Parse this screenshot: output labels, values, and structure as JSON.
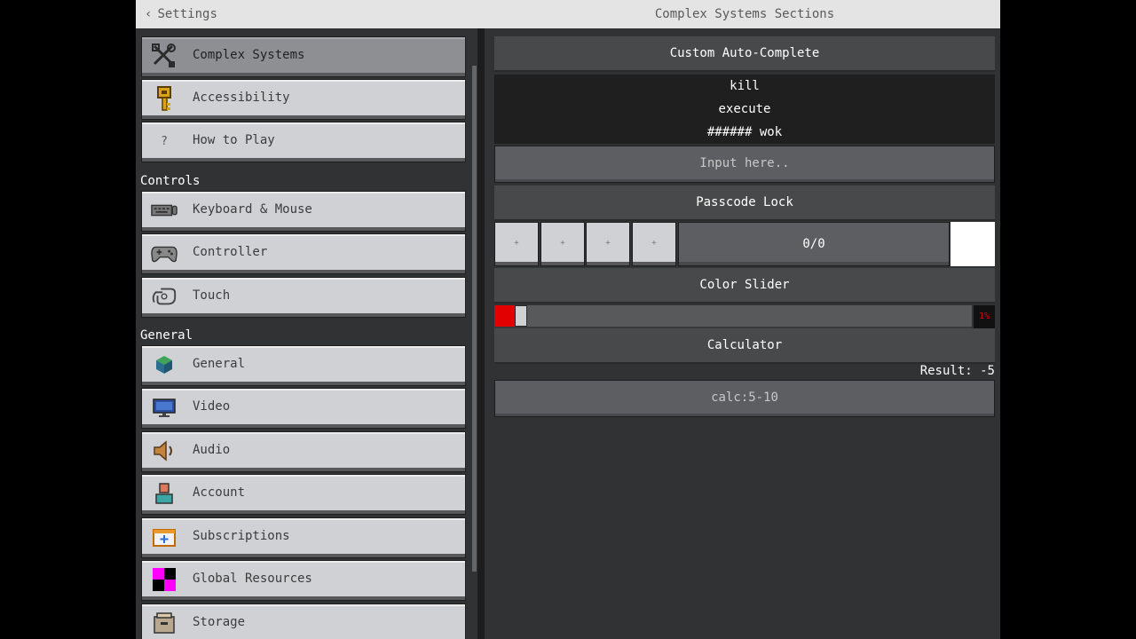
{
  "header": {
    "back_label": "Settings",
    "title": "Complex Systems Sections"
  },
  "sidebar": {
    "top_items": [
      {
        "label": "Complex Systems",
        "icon": "tools-icon",
        "active": true
      },
      {
        "label": "Accessibility",
        "icon": "key-icon"
      },
      {
        "label": "How to Play",
        "icon": "question-icon"
      }
    ],
    "controls_label": "Controls",
    "controls_items": [
      {
        "label": "Keyboard & Mouse",
        "icon": "keyboard-icon"
      },
      {
        "label": "Controller",
        "icon": "controller-icon"
      },
      {
        "label": "Touch",
        "icon": "touch-icon"
      }
    ],
    "general_label": "General",
    "general_items": [
      {
        "label": "General",
        "icon": "cube-icon"
      },
      {
        "label": "Video",
        "icon": "monitor-icon"
      },
      {
        "label": "Audio",
        "icon": "speaker-icon"
      },
      {
        "label": "Account",
        "icon": "account-icon"
      },
      {
        "label": "Subscriptions",
        "icon": "subscriptions-icon"
      },
      {
        "label": "Global Resources",
        "icon": "checker-icon"
      },
      {
        "label": "Storage",
        "icon": "storage-icon"
      }
    ]
  },
  "autocomplete": {
    "title": "Custom Auto-Complete",
    "suggestions": [
      "kill",
      "execute",
      "###### wok"
    ],
    "placeholder": "Input here.."
  },
  "passcode": {
    "title": "Passcode Lock",
    "digits": [
      "+",
      "+",
      "+",
      "+"
    ],
    "display": "0/0"
  },
  "color_slider": {
    "title": "Color Slider",
    "value_label": "1%",
    "value": 0.01,
    "fill_color": "#e30000"
  },
  "calculator": {
    "title": "Calculator",
    "result": "Result: -5",
    "input": "calc:5-10"
  },
  "colors": {
    "background": "#313233",
    "button": "#d0d1d4",
    "active": "#8e8f93",
    "accent_red": "#e30000"
  }
}
